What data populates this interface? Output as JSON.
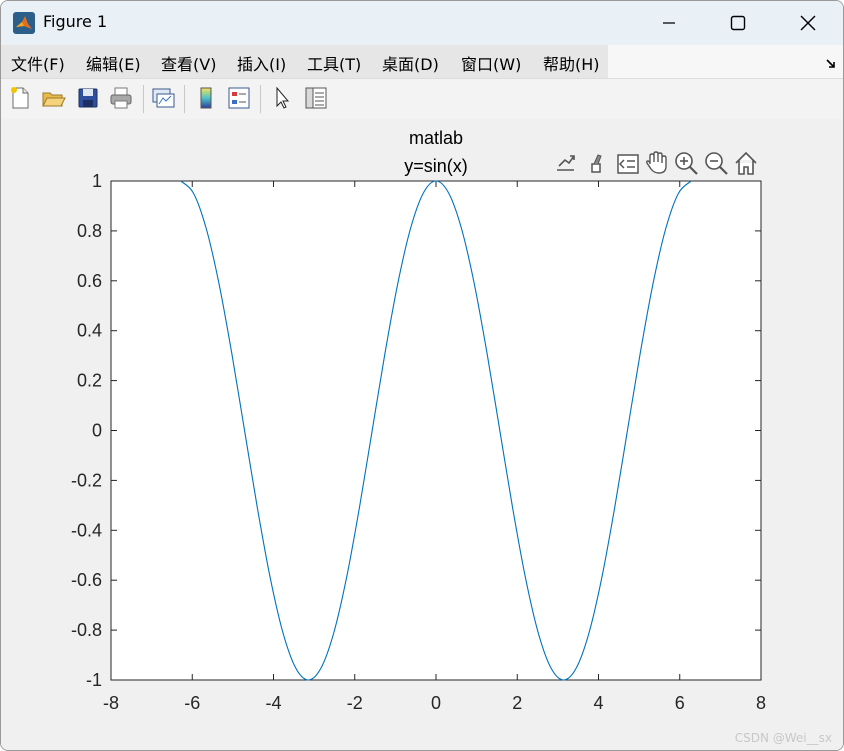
{
  "window": {
    "title": "Figure 1"
  },
  "menu": {
    "items": [
      "文件(F)",
      "编辑(E)",
      "查看(V)",
      "插入(I)",
      "工具(T)",
      "桌面(D)",
      "窗口(W)",
      "帮助(H)"
    ]
  },
  "toolbar": {
    "icons": [
      "new-figure-icon",
      "open-file-icon",
      "save-icon",
      "print-icon",
      "link-plot-icon",
      "insert-colorbar-icon",
      "insert-legend-icon",
      "edit-plot-icon",
      "property-inspector-icon"
    ]
  },
  "axes_toolbar": {
    "icons": [
      "export-icon",
      "brush-icon",
      "data-tips-icon",
      "pan-icon",
      "zoom-in-icon",
      "zoom-out-icon",
      "home-icon"
    ]
  },
  "chart_data": {
    "type": "line",
    "title": "matlab",
    "subtitle": "y=sin(x)",
    "xlabel": "",
    "ylabel": "",
    "xlim": [
      -8,
      8
    ],
    "ylim": [
      -1,
      1
    ],
    "xticks": [
      "-8",
      "-6",
      "-4",
      "-2",
      "0",
      "2",
      "4",
      "6",
      "8"
    ],
    "yticks": [
      "1",
      "0.8",
      "0.6",
      "0.4",
      "0.2",
      "0",
      "-0.2",
      "-0.4",
      "-0.6",
      "-0.8",
      "-1"
    ],
    "grid": false,
    "series": [
      {
        "color": "#0072bd",
        "x": [
          -6.2832,
          -5.969,
          -5.6549,
          -5.3407,
          -5.0265,
          -4.7124,
          -4.3982,
          -4.0841,
          -3.7699,
          -3.4558,
          -3.1416,
          -2.8274,
          -2.5133,
          -2.1991,
          -1.885,
          -1.5708,
          -1.2566,
          -0.9425,
          -0.6283,
          -0.3142,
          0,
          0.3142,
          0.6283,
          0.9425,
          1.2566,
          1.5708,
          1.885,
          2.1991,
          2.5133,
          2.8274,
          3.1416,
          3.4558,
          3.7699,
          4.0841,
          4.3982,
          4.7124,
          5.0265,
          5.3407,
          5.6549,
          5.969,
          6.2832
        ],
        "y": [
          1.0,
          0.9511,
          0.809,
          0.5878,
          0.309,
          0.0,
          -0.309,
          -0.5878,
          -0.809,
          -0.9511,
          -1.0,
          -0.9511,
          -0.809,
          -0.5878,
          -0.309,
          0.0,
          0.309,
          0.5878,
          0.809,
          0.9511,
          1.0,
          0.9511,
          0.809,
          0.5878,
          0.309,
          0.0,
          -0.309,
          -0.5878,
          -0.809,
          -0.9511,
          -1.0,
          -0.9511,
          -0.809,
          -0.5878,
          -0.309,
          0.0,
          0.309,
          0.5878,
          0.809,
          0.9511,
          1.0
        ]
      }
    ]
  },
  "watermark": "CSDN @Wei__sx"
}
